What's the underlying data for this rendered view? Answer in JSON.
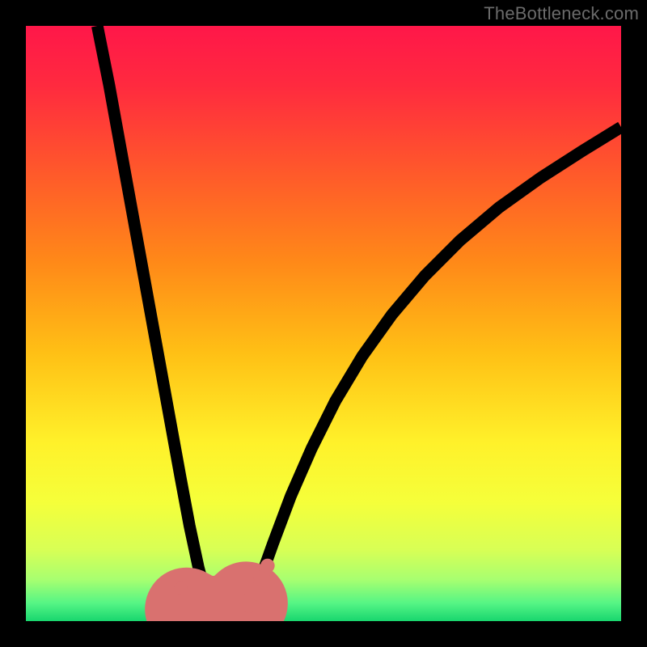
{
  "watermark": "TheBottleneck.com",
  "chart_data": {
    "type": "line",
    "title": "",
    "xlabel": "",
    "ylabel": "",
    "xlim": [
      0,
      100
    ],
    "ylim": [
      0,
      100
    ],
    "gradient_stops": [
      {
        "offset": 0.0,
        "color": "#ff1749"
      },
      {
        "offset": 0.1,
        "color": "#ff2a3f"
      },
      {
        "offset": 0.25,
        "color": "#ff5a2a"
      },
      {
        "offset": 0.4,
        "color": "#ff8a18"
      },
      {
        "offset": 0.55,
        "color": "#ffc015"
      },
      {
        "offset": 0.7,
        "color": "#fff12a"
      },
      {
        "offset": 0.8,
        "color": "#f5ff3a"
      },
      {
        "offset": 0.88,
        "color": "#d8ff55"
      },
      {
        "offset": 0.93,
        "color": "#a8ff70"
      },
      {
        "offset": 0.97,
        "color": "#55f585"
      },
      {
        "offset": 1.0,
        "color": "#18d66e"
      }
    ],
    "series": [
      {
        "name": "curve-left",
        "stroke": "#000000",
        "stroke_width": 2.0,
        "x": [
          12.0,
          14.0,
          16.0,
          18.0,
          20.0,
          22.0,
          24.0,
          26.0,
          27.5,
          29.0,
          30.5,
          32.0
        ],
        "y": [
          100.0,
          90.0,
          79.0,
          68.0,
          57.0,
          46.0,
          35.0,
          24.0,
          16.0,
          9.0,
          3.5,
          0.0
        ]
      },
      {
        "name": "curve-right",
        "stroke": "#000000",
        "stroke_width": 2.0,
        "x": [
          37.0,
          39.0,
          41.5,
          44.5,
          48.0,
          52.0,
          56.5,
          61.5,
          67.0,
          73.0,
          79.5,
          86.5,
          93.5,
          100.0
        ],
        "y": [
          0.0,
          6.0,
          13.0,
          21.0,
          29.0,
          37.0,
          44.5,
          51.5,
          58.0,
          64.0,
          69.5,
          74.5,
          79.0,
          83.0
        ]
      },
      {
        "name": "plateau-band",
        "stroke": "#d9716f",
        "stroke_width": 14.0,
        "linecap": "round",
        "x": [
          27.0,
          29.0,
          31.0,
          33.0,
          35.0,
          37.0
        ],
        "y": [
          2.0,
          0.9,
          0.6,
          0.6,
          1.2,
          3.0
        ]
      }
    ],
    "markers": [
      {
        "name": "dot-left",
        "x": 26.0,
        "y": 5.5,
        "r": 1.1,
        "color": "#d9716f"
      },
      {
        "name": "dot-right-1",
        "x": 37.5,
        "y": 3.0,
        "r": 1.6,
        "color": "#d9716f"
      },
      {
        "name": "dot-right-2",
        "x": 38.7,
        "y": 5.0,
        "r": 1.5,
        "color": "#d9716f"
      },
      {
        "name": "dot-right-3",
        "x": 39.7,
        "y": 7.2,
        "r": 1.4,
        "color": "#d9716f"
      },
      {
        "name": "dot-right-4",
        "x": 40.6,
        "y": 9.3,
        "r": 1.2,
        "color": "#d9716f"
      }
    ]
  }
}
